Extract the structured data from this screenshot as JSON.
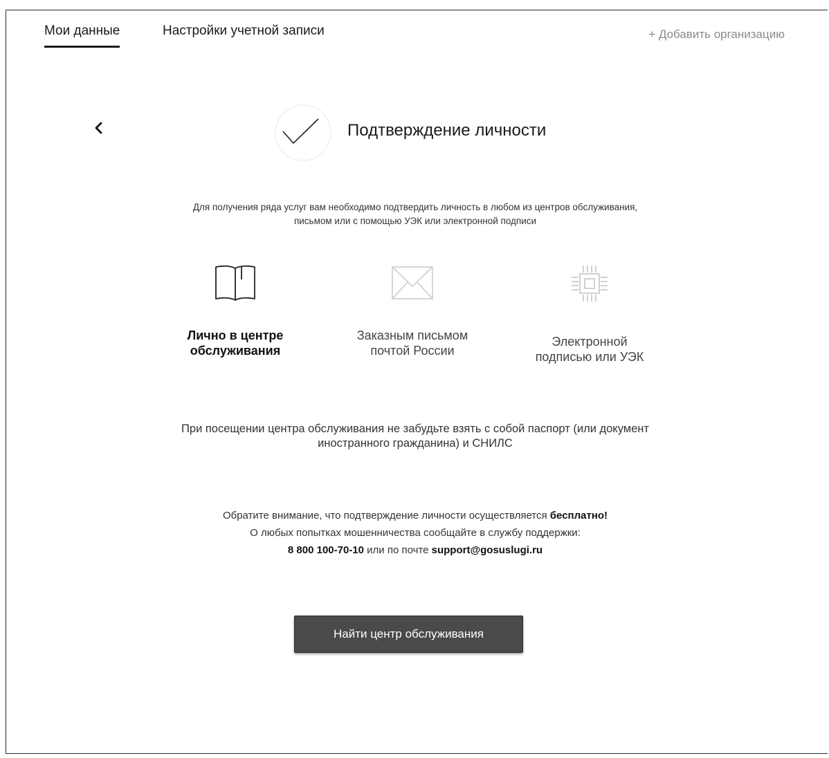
{
  "tabs": {
    "my_data": "Мои данные",
    "account_settings": "Настройки учетной записи"
  },
  "add_organization": "+ Добавить организацию",
  "page": {
    "title": "Подтверждение личности",
    "intro_line1": "Для получения ряда услуг вам необходимо подтвердить личность в любом из центров обслуживания,",
    "intro_line2": "письмом или с помощью УЭК или электронной подписи"
  },
  "methods": [
    {
      "icon": "open-book-icon",
      "line1": "Лично в центре",
      "line2": "обслуживания",
      "selected": true
    },
    {
      "icon": "envelope-icon",
      "line1": "Заказным письмом",
      "line2": "почтой России",
      "selected": false
    },
    {
      "icon": "chip-icon",
      "line1": "Электронной",
      "line2": "подписью или УЭК",
      "selected": false
    }
  ],
  "note": {
    "line1": "При посещении центра обслуживания не забудьте взять с собой паспорт (или документ",
    "line2": "иностранного гражданина) и СНИЛС"
  },
  "warning": {
    "line1_text": "Обратите внимание, что подтверждение личности осуществляется ",
    "line1_bold": "бесплатно!",
    "line2": "О любых попытках мошенничества сообщайте в службу поддержки:",
    "phone": "8 800 100-70-10",
    "line3_mid": " или по почте ",
    "email": "support@gosuslugi.ru"
  },
  "find_button": "Найти центр обслуживания",
  "colors": {
    "button_bg": "#4a4a4a",
    "button_text": "#ffffff",
    "muted_text": "#8a8a8a"
  }
}
